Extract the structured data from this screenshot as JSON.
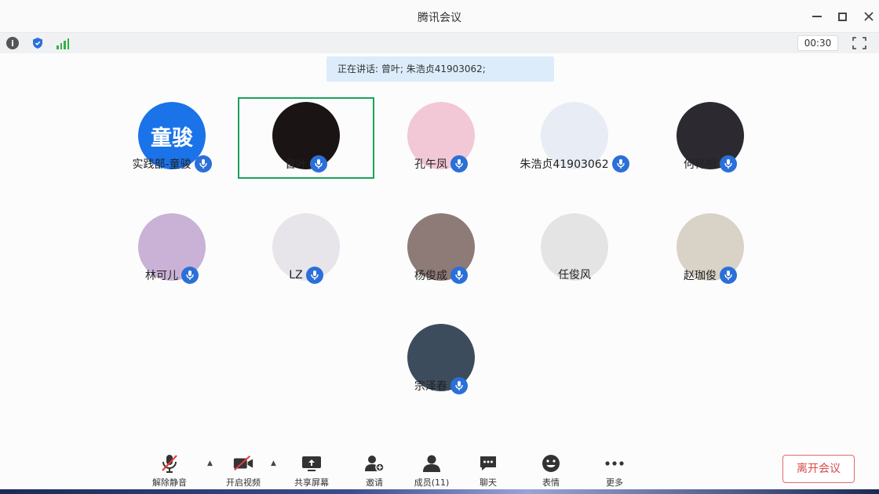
{
  "window": {
    "title": "腾讯会议"
  },
  "status": {
    "timer": "00:30",
    "speaking_text": "正在讲话: 曾叶; 朱浩贞41903062;"
  },
  "colors": {
    "accent": "#2b6fd8",
    "active_border": "#1aa35a",
    "leave": "#d84a4a",
    "banner": "#dcecfb"
  },
  "participants": [
    {
      "name": "实践部-童骏",
      "avatar_text": "童骏",
      "avatar_color": "#1a73e8"
    },
    {
      "name": "曾叶",
      "avatar_text": "",
      "avatar_color": "#1a1414",
      "active": true
    },
    {
      "name": "孔午凤",
      "avatar_text": "",
      "avatar_color": "#f2c8d6"
    },
    {
      "name": "朱浩贞41903062",
      "avatar_text": "",
      "avatar_color": "#e8ecf4"
    },
    {
      "name": "何梓桐",
      "avatar_text": "",
      "avatar_color": "#2c2a30"
    },
    {
      "name": "林可儿",
      "avatar_text": "",
      "avatar_color": "#c9b2d6"
    },
    {
      "name": "LZ",
      "avatar_text": "",
      "avatar_color": "#e7e4ea"
    },
    {
      "name": "杨俊成",
      "avatar_text": "",
      "avatar_color": "#8e7a77"
    },
    {
      "name": "任俊风",
      "avatar_text": "",
      "avatar_color": "#e4e4e4"
    },
    {
      "name": "赵珈俊",
      "avatar_text": "",
      "avatar_color": "#d9d2c6"
    },
    {
      "name": "宗泽春",
      "avatar_text": "",
      "avatar_color": "#3c4c5c"
    }
  ],
  "toolbar": {
    "mute": "解除静音",
    "video": "开启视频",
    "share": "共享屏幕",
    "invite": "邀请",
    "members": "成员(11)",
    "chat": "聊天",
    "emoji": "表情",
    "more": "更多",
    "leave": "离开会议"
  }
}
